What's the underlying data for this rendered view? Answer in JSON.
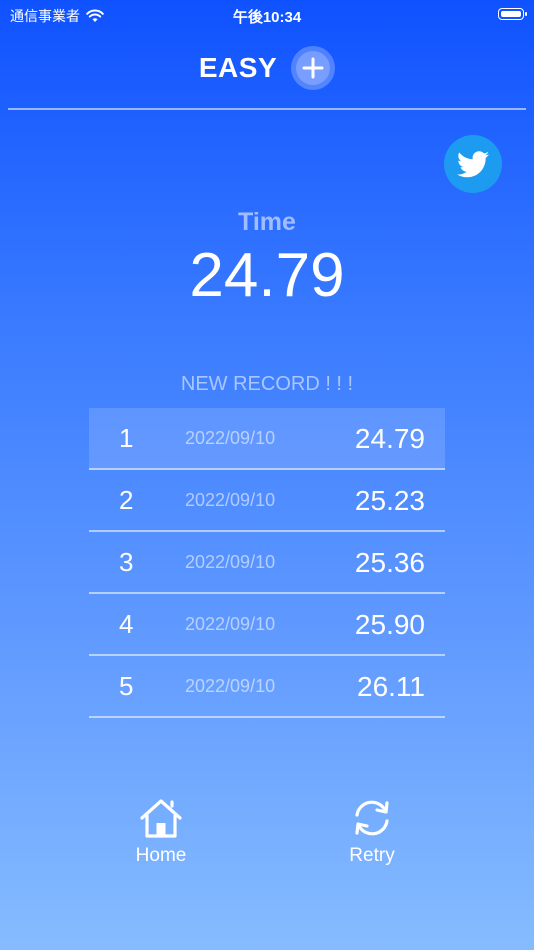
{
  "status_bar": {
    "carrier": "通信事業者",
    "time": "午後10:34"
  },
  "header": {
    "mode": "EASY"
  },
  "result": {
    "time_label": "Time",
    "time_value": "24.79",
    "new_record_text": "NEW RECORD ! ! !"
  },
  "records": [
    {
      "rank": "1",
      "date": "2022/09/10",
      "score": "24.79"
    },
    {
      "rank": "2",
      "date": "2022/09/10",
      "score": "25.23"
    },
    {
      "rank": "3",
      "date": "2022/09/10",
      "score": "25.36"
    },
    {
      "rank": "4",
      "date": "2022/09/10",
      "score": "25.90"
    },
    {
      "rank": "5",
      "date": "2022/09/10",
      "score": "26.11"
    }
  ],
  "nav": {
    "home_label": "Home",
    "retry_label": "Retry"
  },
  "colors": {
    "twitter": "#1d9bf0"
  }
}
